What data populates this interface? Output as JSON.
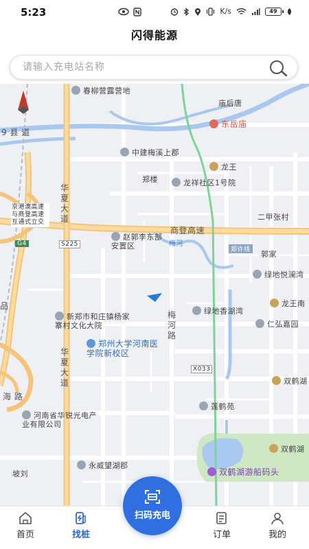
{
  "status": {
    "time": "5:23",
    "battery": "49",
    "net": "K/s"
  },
  "header": {
    "title": "闪得能源"
  },
  "search": {
    "placeholder": "请输入充电站名称"
  },
  "map": {
    "labels": {
      "chunliu": "春柳营露营地",
      "miaohoutang": "庙后唐",
      "dongyuemiao": "东岳庙",
      "xian": "9 县 道",
      "zhongjian": "中建梅溪上郡",
      "longwang": "龙王",
      "zhenglou": "郑楼",
      "longxiang": "龙祥社区1号院",
      "huaxia1": "华夏大道",
      "jinggang": "京港澳高速与商登高速互通式立交",
      "g4": "G4",
      "s225": "S225",
      "zhaoguo": "赵郭李东部安置区",
      "shangdeng": "商登高速",
      "erjia": "二甲张村",
      "meihe": "梅河",
      "zhengxu": "郑许线",
      "guojia": "郭家",
      "lvdi_yue": "绿地悦澜湾",
      "xinzheng": "新郑市和庄镇杨家寨村文化大院",
      "lvdi_xiang": "绿地香湖湾",
      "longwangnan": "龙王南",
      "meihelu": "梅河路",
      "renhong": "仁弘嘉园",
      "zhengda": "郑州大学河南医学院新校区",
      "huaxia2": "华夏大道",
      "pin_left": "品",
      "x033": "X033",
      "shuanghe_hu": "双鹤湖",
      "hailu": "海 路",
      "lianhe": "莲鹤苑",
      "henan": "河南省华锐光电产业有限公司",
      "shuanghe2": "双鹤湖",
      "yongwei": "永威望湖郡",
      "poliu": "坡刘",
      "youchuan": "双鹤湖游船码头"
    }
  },
  "fab": {
    "scan_label": "扫码充电"
  },
  "nav": {
    "home": "首页",
    "find": "找桩",
    "orders": "订单",
    "mine": "我的"
  }
}
